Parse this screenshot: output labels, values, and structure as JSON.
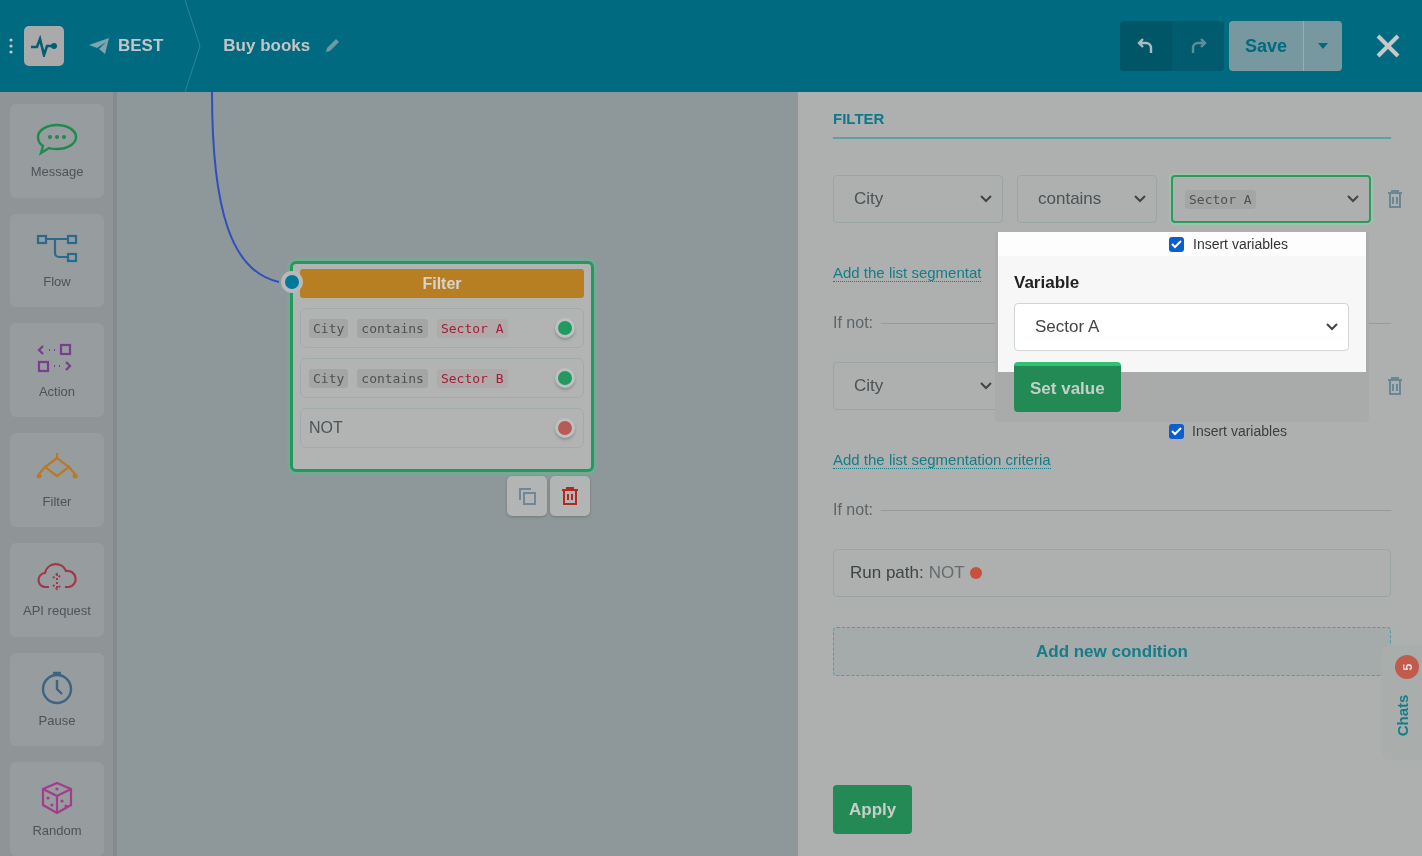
{
  "header": {
    "brand": "BEST",
    "title": "Buy books",
    "save_label": "Save"
  },
  "sidebar": {
    "items": [
      {
        "label": "Message",
        "kind": "message"
      },
      {
        "label": "Flow",
        "kind": "flow"
      },
      {
        "label": "Action",
        "kind": "action"
      },
      {
        "label": "Filter",
        "kind": "filter"
      },
      {
        "label": "API request",
        "kind": "api"
      },
      {
        "label": "Pause",
        "kind": "pause"
      },
      {
        "label": "Random",
        "kind": "random"
      }
    ]
  },
  "node": {
    "title": "Filter",
    "rows": [
      {
        "kind": "condition",
        "field": "City",
        "operator": "contains",
        "value": "Sector A",
        "color": "#229a5f"
      },
      {
        "kind": "condition",
        "field": "City",
        "operator": "contains",
        "value": "Sector B",
        "color": "#229a5f"
      },
      {
        "kind": "else",
        "label": "NOT",
        "color": "#b85a55"
      }
    ]
  },
  "panel": {
    "title": "FILTER",
    "conditions": [
      {
        "field": "City",
        "operator": "contains",
        "value": "Sector A",
        "focused": true,
        "link": "Add the list segmentat",
        "else_label": "If not:"
      },
      {
        "field": "City",
        "insert_variables": {
          "label": "Insert variables",
          "checked": true
        },
        "link": "Add the list segmentation criteria",
        "else_label": "If not:"
      }
    ],
    "run_path": {
      "label": "Run path:",
      "value": "NOT",
      "color": "#c9503b"
    },
    "add_condition": "Add new condition",
    "apply": "Apply"
  },
  "popup": {
    "insert_variables": {
      "label": "Insert variables",
      "checked": true
    },
    "label": "Variable",
    "value": "Sector A",
    "button": "Set value"
  },
  "chats": {
    "label": "Chats",
    "badge": "5"
  }
}
